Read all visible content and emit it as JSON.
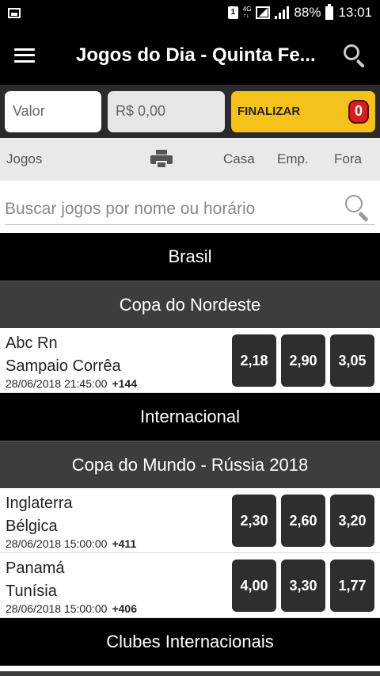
{
  "status": {
    "sim": "1",
    "network": [
      "4G",
      "↑↓"
    ],
    "battery": "88%",
    "time": "13:01"
  },
  "appbar": {
    "title": "Jogos do Dia - Quinta Fe..."
  },
  "betbar": {
    "valor_placeholder": "Valor",
    "amount": "R$ 0,00",
    "finalizar": "FINALIZAR",
    "count": "0"
  },
  "columns": {
    "jogos": "Jogos",
    "casa": "Casa",
    "emp": "Emp.",
    "fora": "Fora"
  },
  "search": {
    "placeholder": "Buscar jogos por nome ou horário"
  },
  "sections": {
    "brasil": {
      "country": "Brasil",
      "league": "Copa do Nordeste",
      "games": [
        {
          "home": "Abc Rn",
          "away": "Sampaio Corrêa",
          "datetime": "28/06/2018 21:45:00",
          "more": "+144",
          "odds": [
            "2,18",
            "2,90",
            "3,05"
          ]
        }
      ]
    },
    "internacional": {
      "country": "Internacional",
      "league": "Copa do Mundo - Rússia 2018",
      "games": [
        {
          "home": "Inglaterra",
          "away": "Bélgica",
          "datetime": "28/06/2018 15:00:00",
          "more": "+411",
          "odds": [
            "2,30",
            "2,60",
            "3,20"
          ]
        },
        {
          "home": "Panamá",
          "away": "Tunísia",
          "datetime": "28/06/2018 15:00:00",
          "more": "+406",
          "odds": [
            "4,00",
            "3,30",
            "1,77"
          ]
        }
      ]
    },
    "clubes": {
      "country": "Clubes Internacionais"
    }
  }
}
